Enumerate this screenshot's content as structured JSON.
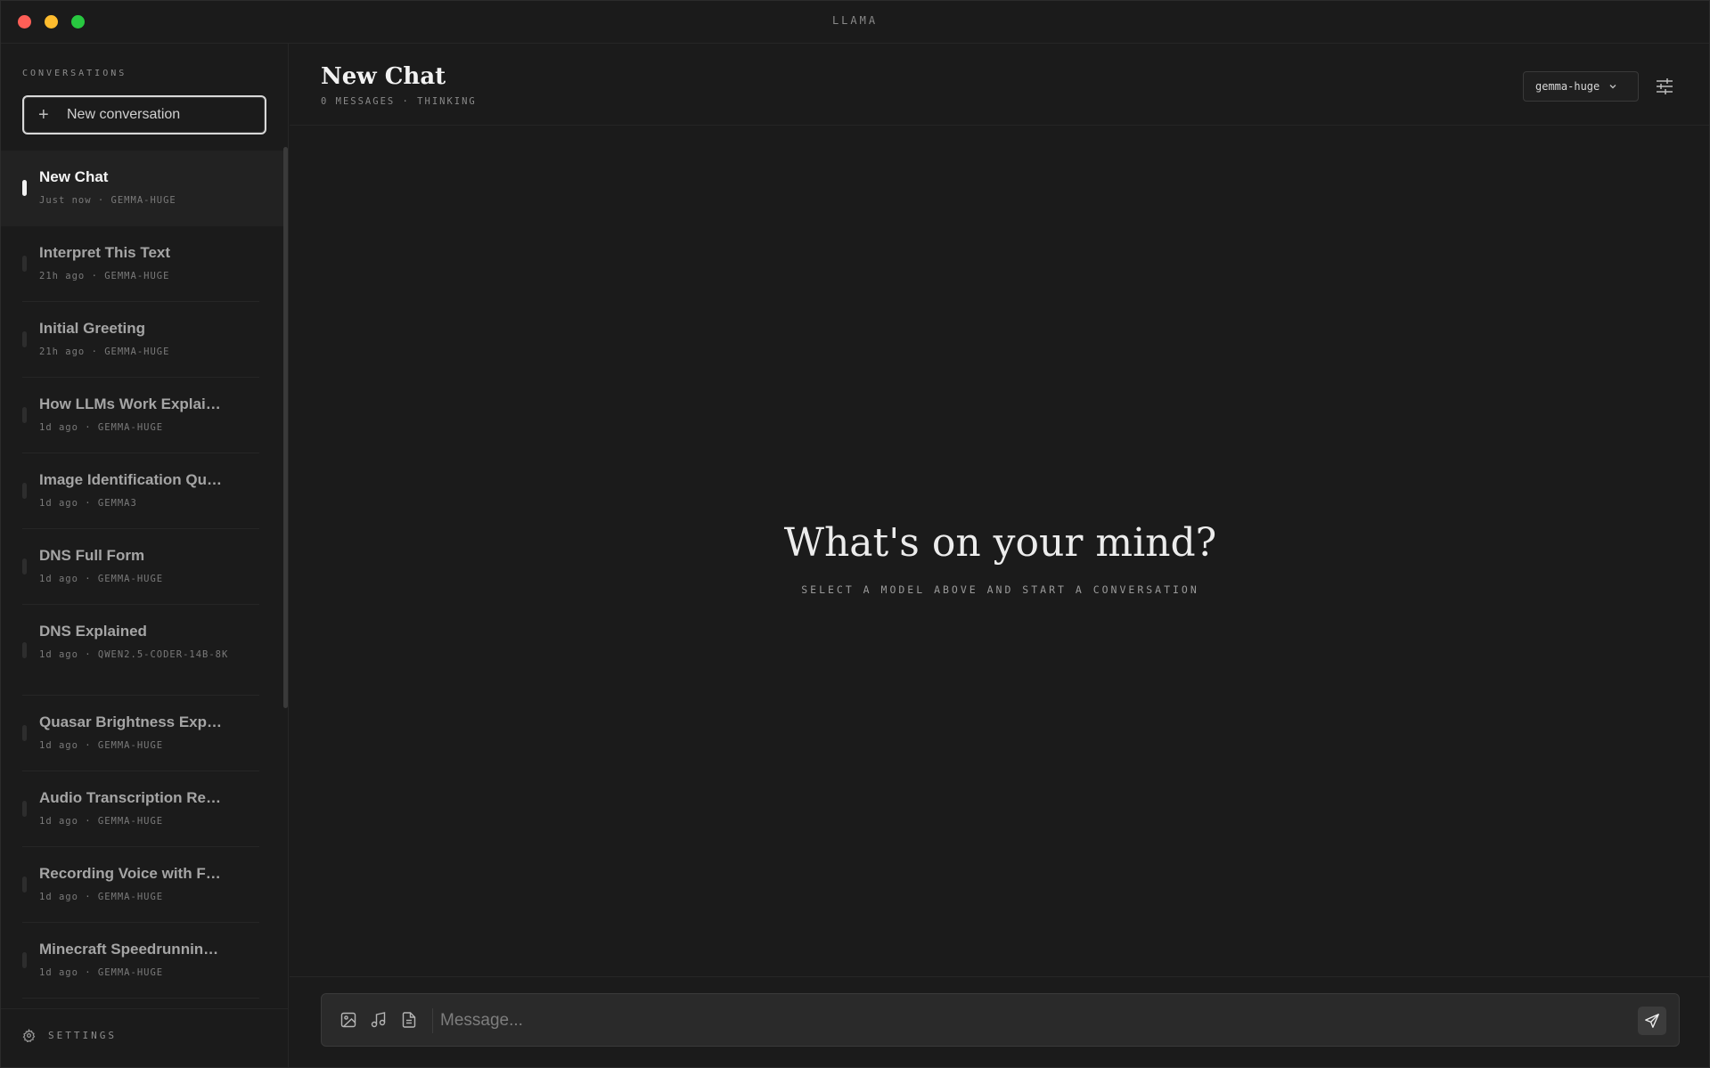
{
  "app": {
    "title": "LLAMA"
  },
  "sidebar": {
    "heading": "CONVERSATIONS",
    "new_button": {
      "label": "New conversation",
      "icon": "plus-icon"
    },
    "conversations": [
      {
        "title": "New Chat",
        "meta": "Just now · GEMMA-HUGE",
        "active": true
      },
      {
        "title": "Interpret This Text",
        "meta": "21h ago · GEMMA-HUGE"
      },
      {
        "title": "Initial Greeting",
        "meta": "21h ago · GEMMA-HUGE"
      },
      {
        "title": "How LLMs Work Explai…",
        "meta": "1d ago · GEMMA-HUGE"
      },
      {
        "title": "Image Identification Qu…",
        "meta": "1d ago · GEMMA3"
      },
      {
        "title": "DNS Full Form",
        "meta": "1d ago · GEMMA-HUGE"
      },
      {
        "title": "DNS Explained",
        "meta": "1d ago · QWEN2.5-CODER-14B-8K"
      },
      {
        "title": "Quasar Brightness Exp…",
        "meta": "1d ago · GEMMA-HUGE"
      },
      {
        "title": "Audio Transcription Re…",
        "meta": "1d ago · GEMMA-HUGE"
      },
      {
        "title": "Recording Voice with F…",
        "meta": "1d ago · GEMMA-HUGE"
      },
      {
        "title": "Minecraft Speedrunnin…",
        "meta": "1d ago · GEMMA-HUGE"
      }
    ],
    "footer": {
      "settings_label": "SETTINGS",
      "icon": "gear-icon"
    }
  },
  "main": {
    "title": "New Chat",
    "subtitle": "0 MESSAGES · THINKING",
    "model_select": {
      "value": "gemma-huge"
    },
    "empty_state": {
      "title": "What's on your mind?",
      "subtitle": "SELECT A MODEL ABOVE AND START A CONVERSATION"
    },
    "composer": {
      "placeholder": "Message...",
      "attachments": [
        "image-icon",
        "music-icon",
        "document-icon"
      ],
      "send_icon": "send-icon"
    }
  },
  "colors": {
    "background": "#1b1b1b",
    "composer": "#2a2a2a",
    "active_marker": "#f2f2f2",
    "close": "#fe5f57",
    "minimize": "#febc2e",
    "maximize": "#28c840"
  }
}
